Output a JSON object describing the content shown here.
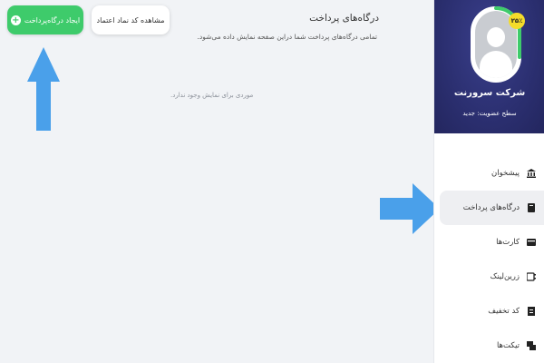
{
  "header": {
    "title": "درگاه‌های پرداخت",
    "subtitle": "تمامی درگاه‌های پرداخت شما دراین صفحه نمایش داده می‌شود."
  },
  "toolbar": {
    "create_label": "ایجاد درگاه‌پرداخت",
    "trust_badge_label": "مشاهده کد نماد اعتماد"
  },
  "main": {
    "empty_text": "موردی برای نمایش وجود ندارد."
  },
  "profile": {
    "badge": "۲۵٪",
    "company": "شرکت سرورنت",
    "membership": "سطح عضویت: جدید",
    "progress_percent": 25
  },
  "sidebar": {
    "items": [
      {
        "label": "پیشخوان",
        "icon": "bank-icon",
        "active": false
      },
      {
        "label": "درگاه‌های پرداخت",
        "icon": "gateway-icon",
        "active": true
      },
      {
        "label": "کارت‌ها",
        "icon": "cards-icon",
        "active": false
      },
      {
        "label": "زرین‌لینک",
        "icon": "link-icon",
        "active": false
      },
      {
        "label": "کد تخفیف",
        "icon": "discount-icon",
        "active": false
      },
      {
        "label": "تیکت‌ها",
        "icon": "ticket-icon",
        "active": false
      }
    ]
  },
  "colors": {
    "accent_green": "#3ecb6b",
    "sidebar_header": "#2b2f70",
    "arrow_blue": "#4aa0ea",
    "badge_yellow": "#f4dc2a"
  }
}
